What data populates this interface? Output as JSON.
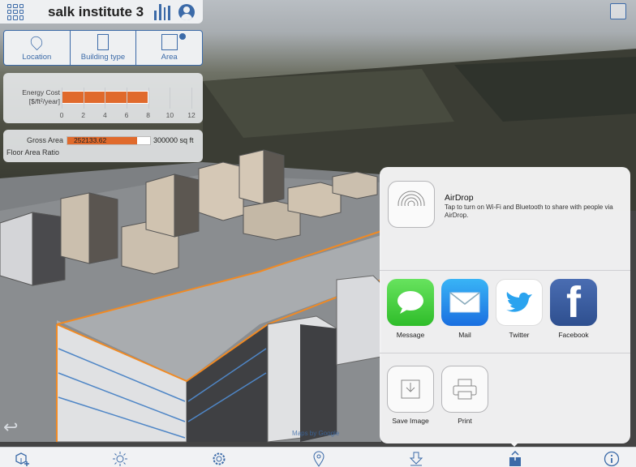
{
  "header": {
    "title": "salk institute 3"
  },
  "tabs": [
    {
      "label": "Location",
      "icon": "location-pin-icon"
    },
    {
      "label": "Building type",
      "icon": "building-icon"
    },
    {
      "label": "Area",
      "icon": "area-icon"
    }
  ],
  "energy_cost": {
    "label_line1": "Energy Cost",
    "label_line2": "[$/ft²/year]",
    "value": 8,
    "axis_max": 12,
    "ticks": [
      "0",
      "2",
      "4",
      "6",
      "8",
      "10",
      "12"
    ]
  },
  "gross_area": {
    "label": "Gross Area",
    "value_text": "252133.62",
    "value": 252133.62,
    "max_text": "300000 sq ft",
    "max": 300000,
    "far_label": "Floor Area Ratio"
  },
  "share_sheet": {
    "airdrop": {
      "title": "AirDrop",
      "description": "Tap to turn on Wi-Fi and Bluetooth to share with people via AirDrop."
    },
    "apps": [
      {
        "label": "Message",
        "icon": "messages-icon"
      },
      {
        "label": "Mail",
        "icon": "mail-icon"
      },
      {
        "label": "Twitter",
        "icon": "twitter-icon"
      },
      {
        "label": "Facebook",
        "icon": "facebook-icon"
      }
    ],
    "actions": [
      {
        "label": "Save Image",
        "icon": "save-image-icon"
      },
      {
        "label": "Print",
        "icon": "print-icon"
      }
    ]
  },
  "map_credit": "Maps by Google",
  "colors": {
    "accent": "#3b6aa8",
    "bar": "#e06a2c",
    "outline": "#f08a24"
  },
  "toolbar": [
    "add-model-icon",
    "sun-icon",
    "settings-icon",
    "location-icon",
    "download-icon",
    "share-icon",
    "info-icon"
  ]
}
